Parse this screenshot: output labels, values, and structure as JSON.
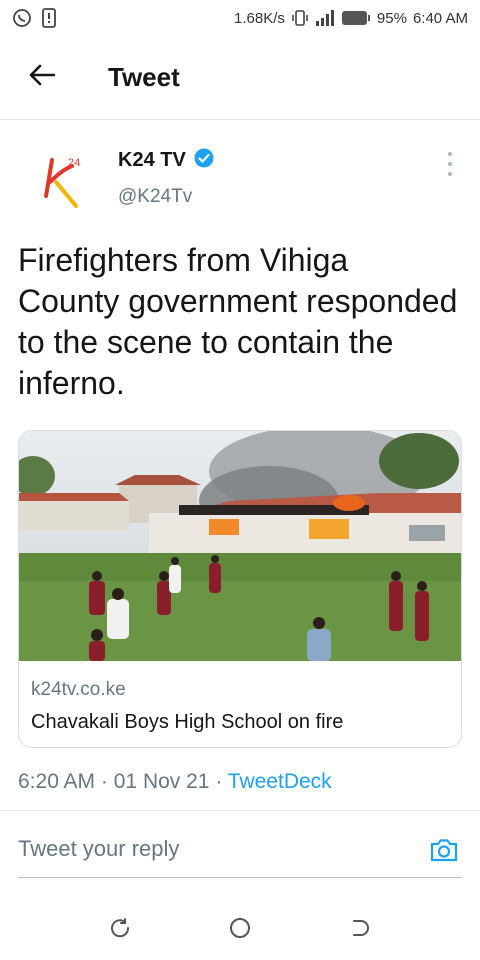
{
  "status_bar": {
    "speed": "1.68K/s",
    "battery": "95%",
    "time": "6:40 AM",
    "icons": [
      "whatsapp-icon",
      "sim-alert-icon",
      "vibrate-icon",
      "signal-icon",
      "battery-icon"
    ]
  },
  "header": {
    "title": "Tweet",
    "back_icon": "arrow-left-icon"
  },
  "tweet": {
    "avatar_logo_text": "k24",
    "display_name": "K24 TV",
    "verified": true,
    "handle": "@K24Tv",
    "text": "Firefighters from Vihiga County government responded to the scene to contain the inferno.",
    "card": {
      "domain": "k24tv.co.ke",
      "title": "Chavakali Boys High School on fire",
      "image": "photo of a burning school building with students on a grass field"
    },
    "time": "6:20 AM",
    "separator": "·",
    "date": "01 Nov 21",
    "source": "TweetDeck"
  },
  "reply": {
    "placeholder": "Tweet your reply"
  },
  "colors": {
    "accent": "#1da1f2",
    "text": "#14171a",
    "muted": "#657786",
    "logo_red": "#e0392b",
    "logo_yellow": "#f5b301"
  }
}
